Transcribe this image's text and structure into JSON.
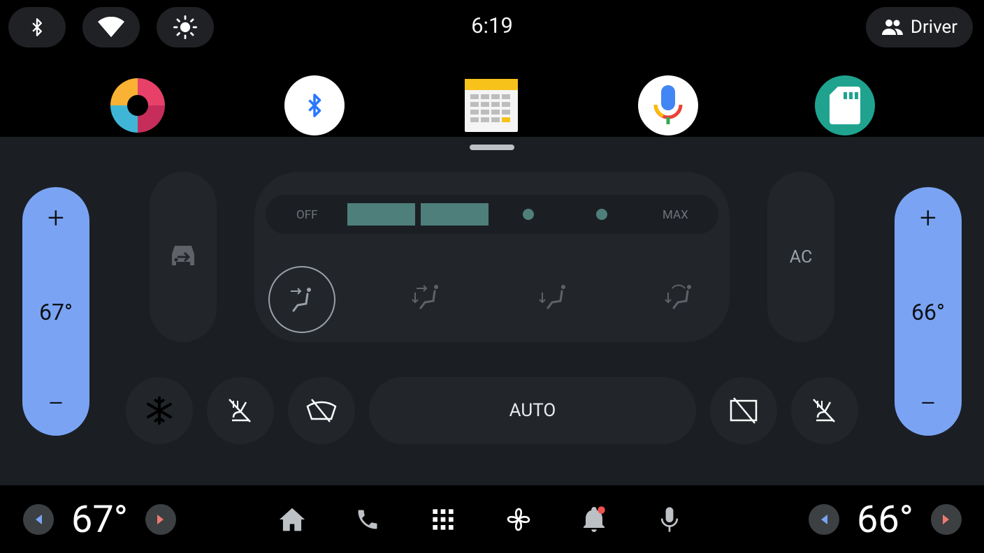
{
  "status_bar": {
    "time": "6:19",
    "user_label": "Driver"
  },
  "apps": [
    {
      "name": "colorful-app"
    },
    {
      "name": "bluetooth"
    },
    {
      "name": "calendar"
    },
    {
      "name": "voice-assistant"
    },
    {
      "name": "sd-card"
    }
  ],
  "hvac": {
    "left_temp": "67°",
    "right_temp": "66°",
    "fan_off_label": "OFF",
    "fan_max_label": "MAX",
    "fan_speed_level": 2,
    "fan_speed_levels": 4,
    "ac_label": "AC",
    "auto_label": "AUTO",
    "selected_airflow": "face"
  },
  "nav_bar": {
    "left_temp": "67°",
    "right_temp": "66°"
  },
  "colors": {
    "accent_blue": "#7aa4f3",
    "fan_active": "#4f7f7b",
    "panel_bg": "#1b1f24",
    "control_bg": "#22262b",
    "notification_dot": "#ef5350"
  }
}
